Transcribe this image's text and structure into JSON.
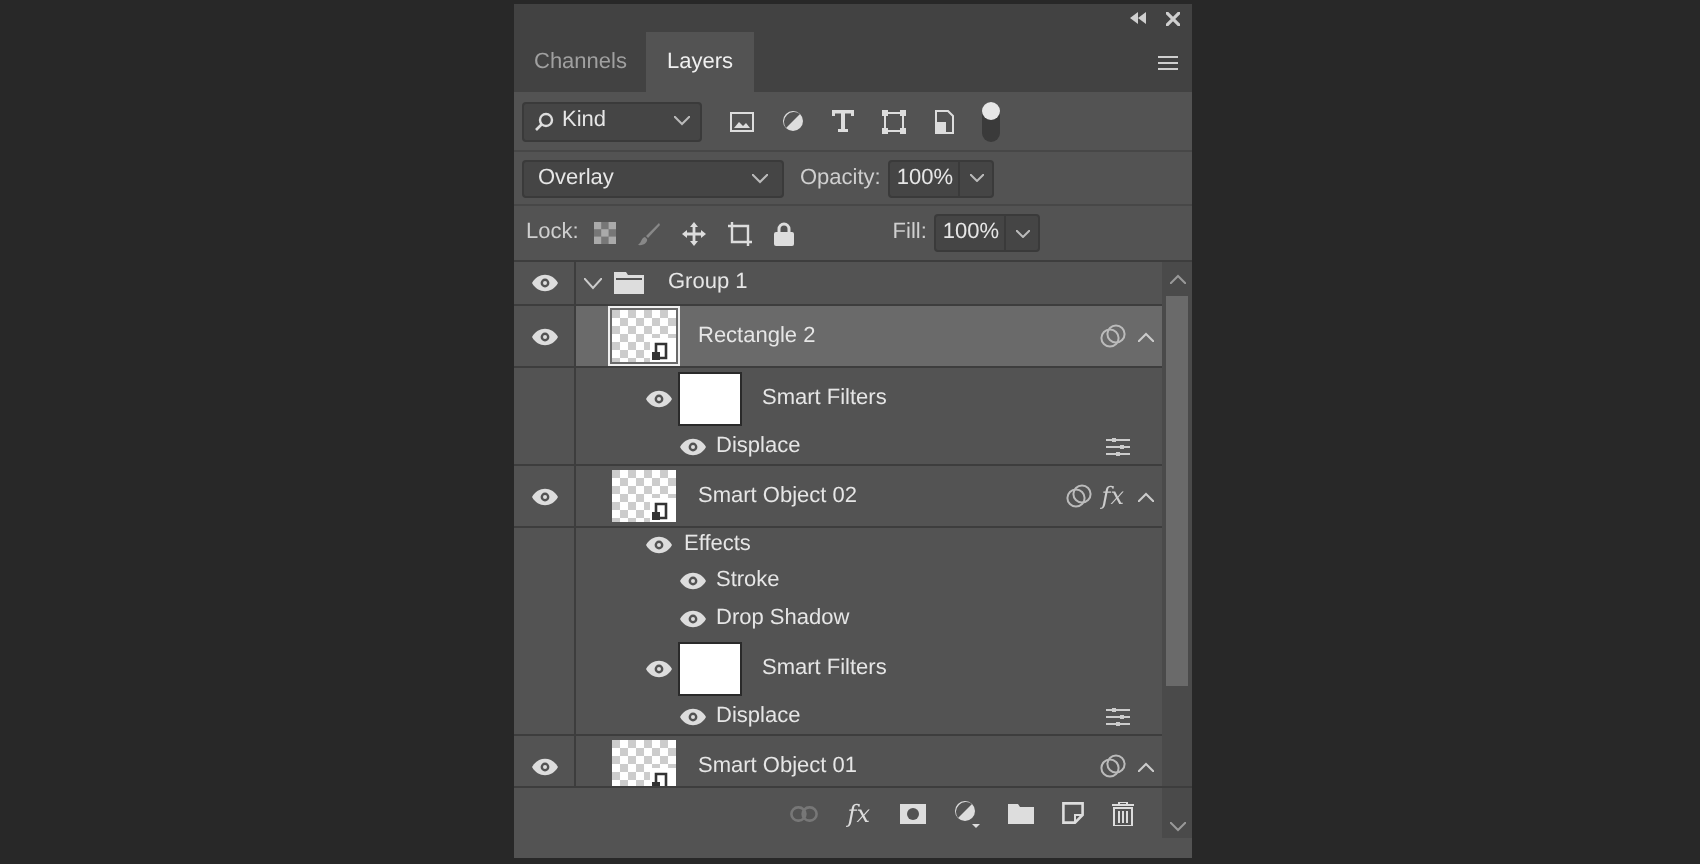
{
  "tabs": [
    {
      "label": "Channels",
      "selected": false
    },
    {
      "label": "Layers",
      "selected": true
    }
  ],
  "filter": {
    "value": "Kind",
    "on": true
  },
  "blend_mode": {
    "value": "Overlay"
  },
  "opacity": {
    "label": "Opacity:",
    "value": "100%"
  },
  "lock": {
    "label": "Lock:"
  },
  "fill": {
    "label": "Fill:",
    "value": "100%"
  },
  "layers": [
    {
      "kind": "group",
      "name": "Group 1",
      "visible": true,
      "expanded": true,
      "children": [
        {
          "kind": "layer",
          "name": "Rectangle 2",
          "visible": true,
          "selected": true,
          "expanded": true,
          "children": [
            {
              "kind": "smart-filters",
              "name": "Smart Filters",
              "visible": true,
              "children": [
                {
                  "kind": "filter",
                  "name": "Displace",
                  "visible": true
                }
              ]
            }
          ]
        },
        {
          "kind": "layer",
          "name": "Smart Object 02",
          "visible": true,
          "selected": false,
          "expanded": true,
          "fx": "fx",
          "children": [
            {
              "kind": "effects",
              "name": "Effects",
              "visible": true,
              "children": [
                {
                  "kind": "effect",
                  "name": "Stroke",
                  "visible": true
                },
                {
                  "kind": "effect",
                  "name": "Drop Shadow",
                  "visible": true
                }
              ]
            },
            {
              "kind": "smart-filters",
              "name": "Smart Filters",
              "visible": true,
              "children": [
                {
                  "kind": "filter",
                  "name": "Displace",
                  "visible": true
                }
              ]
            }
          ]
        },
        {
          "kind": "layer",
          "name": "Smart Object 01",
          "visible": true,
          "selected": false,
          "expanded": true
        }
      ]
    }
  ],
  "footer": {
    "fx_label": "fx"
  }
}
